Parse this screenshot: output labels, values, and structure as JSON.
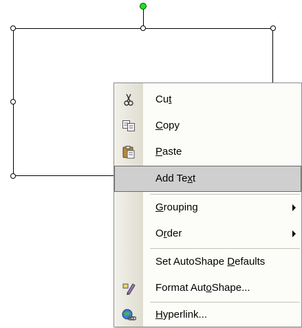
{
  "menu": {
    "items": [
      {
        "label_pre": "Cu",
        "label_ul": "t",
        "label_post": "",
        "icon": "scissors-icon"
      },
      {
        "label_pre": "",
        "label_ul": "C",
        "label_post": "opy",
        "icon": "copy-icon"
      },
      {
        "label_pre": "",
        "label_ul": "P",
        "label_post": "aste",
        "icon": "paste-icon"
      },
      {
        "label_pre": "Add Te",
        "label_ul": "x",
        "label_post": "t",
        "icon": "",
        "highlighted": true
      },
      {
        "label_pre": "",
        "label_ul": "G",
        "label_post": "rouping",
        "icon": "",
        "submenu": true
      },
      {
        "label_pre": "O",
        "label_ul": "r",
        "label_post": "der",
        "icon": "",
        "submenu": true
      },
      {
        "label_pre": "Set AutoShape ",
        "label_ul": "D",
        "label_post": "efaults",
        "icon": ""
      },
      {
        "label_pre": "Format Aut",
        "label_ul": "o",
        "label_post": "Shape...",
        "icon": "format-shape-icon"
      },
      {
        "label_pre": "",
        "label_ul": "H",
        "label_post": "yperlink...",
        "icon": "hyperlink-icon"
      }
    ]
  },
  "colors": {
    "rotation_handle": "#22dd22",
    "highlight": "#cfcfcf",
    "menu_bg": "#fcfcf9"
  }
}
